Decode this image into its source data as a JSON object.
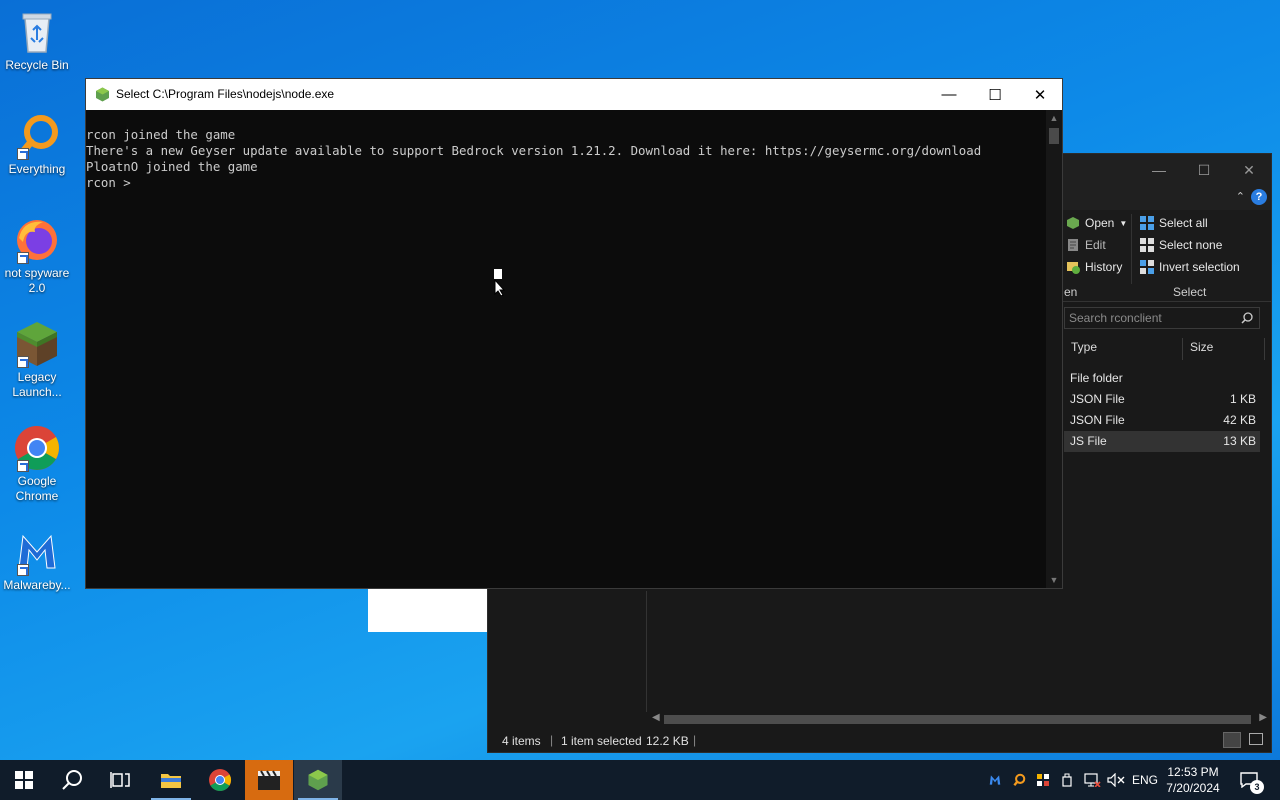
{
  "desktop": {
    "icons": [
      {
        "label": "Recycle Bin"
      },
      {
        "label": "Everything"
      },
      {
        "label": "not spyware 2.0"
      },
      {
        "label": "Legacy Launch..."
      },
      {
        "label": "Google Chrome"
      },
      {
        "label": "Malwareby..."
      }
    ]
  },
  "console": {
    "title": "Select C:\\Program Files\\nodejs\\node.exe",
    "lines": [
      "rcon joined the game",
      "There's a new Geyser update available to support Bedrock version 1.21.2. Download it here: https://geysermc.org/download",
      "PloatnO joined the game",
      "rcon > "
    ]
  },
  "explorer": {
    "ribbon": {
      "open_label": "Open",
      "edit_label": "Edit",
      "history_label": "History",
      "select_all_label": "Select all",
      "select_none_label": "Select none",
      "invert_selection_label": "Invert selection",
      "open_group_label": "en",
      "select_group_label": "Select"
    },
    "search_placeholder": "Search rconclient",
    "columns": {
      "type": "Type",
      "size": "Size"
    },
    "files": [
      {
        "type": "File folder",
        "size": ""
      },
      {
        "type": "JSON File",
        "size": "1 KB"
      },
      {
        "type": "JSON File",
        "size": "42 KB"
      },
      {
        "type": "JS File",
        "size": "13 KB"
      }
    ],
    "status": {
      "items": "4 items",
      "selected": "1 item selected",
      "size": "12.2 KB"
    }
  },
  "taskbar": {
    "language": "ENG",
    "time": "12:53 PM",
    "date": "7/20/2024",
    "notification_count": "3"
  },
  "colors": {
    "desktop_blue": "#0d8ae8",
    "console_bg": "#0c0c0c",
    "console_text": "#cccccc",
    "taskbar": "#101c2a"
  }
}
